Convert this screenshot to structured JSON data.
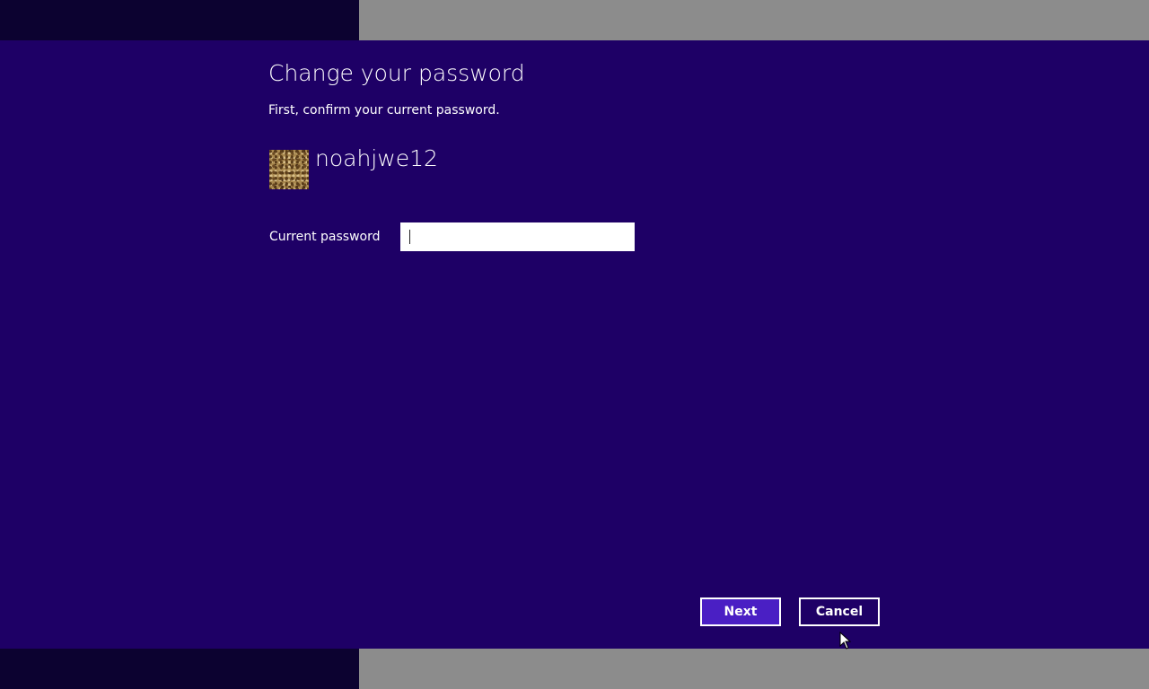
{
  "dialog": {
    "title": "Change your password",
    "subtitle": "First, confirm your current password.",
    "username": "noahjwe12",
    "password_label": "Current password",
    "password_value": "",
    "buttons": {
      "next_label": "Next",
      "cancel_label": "Cancel"
    }
  },
  "colors": {
    "background": "#1e0066",
    "primary_button": "#4a1fc4",
    "side_bar_gray": "#8c8c8c",
    "side_bar_dark": "#0c0230",
    "text": "#ffffff"
  },
  "icons": {
    "avatar": "user-avatar-image",
    "cursor": "mouse-pointer-icon"
  }
}
